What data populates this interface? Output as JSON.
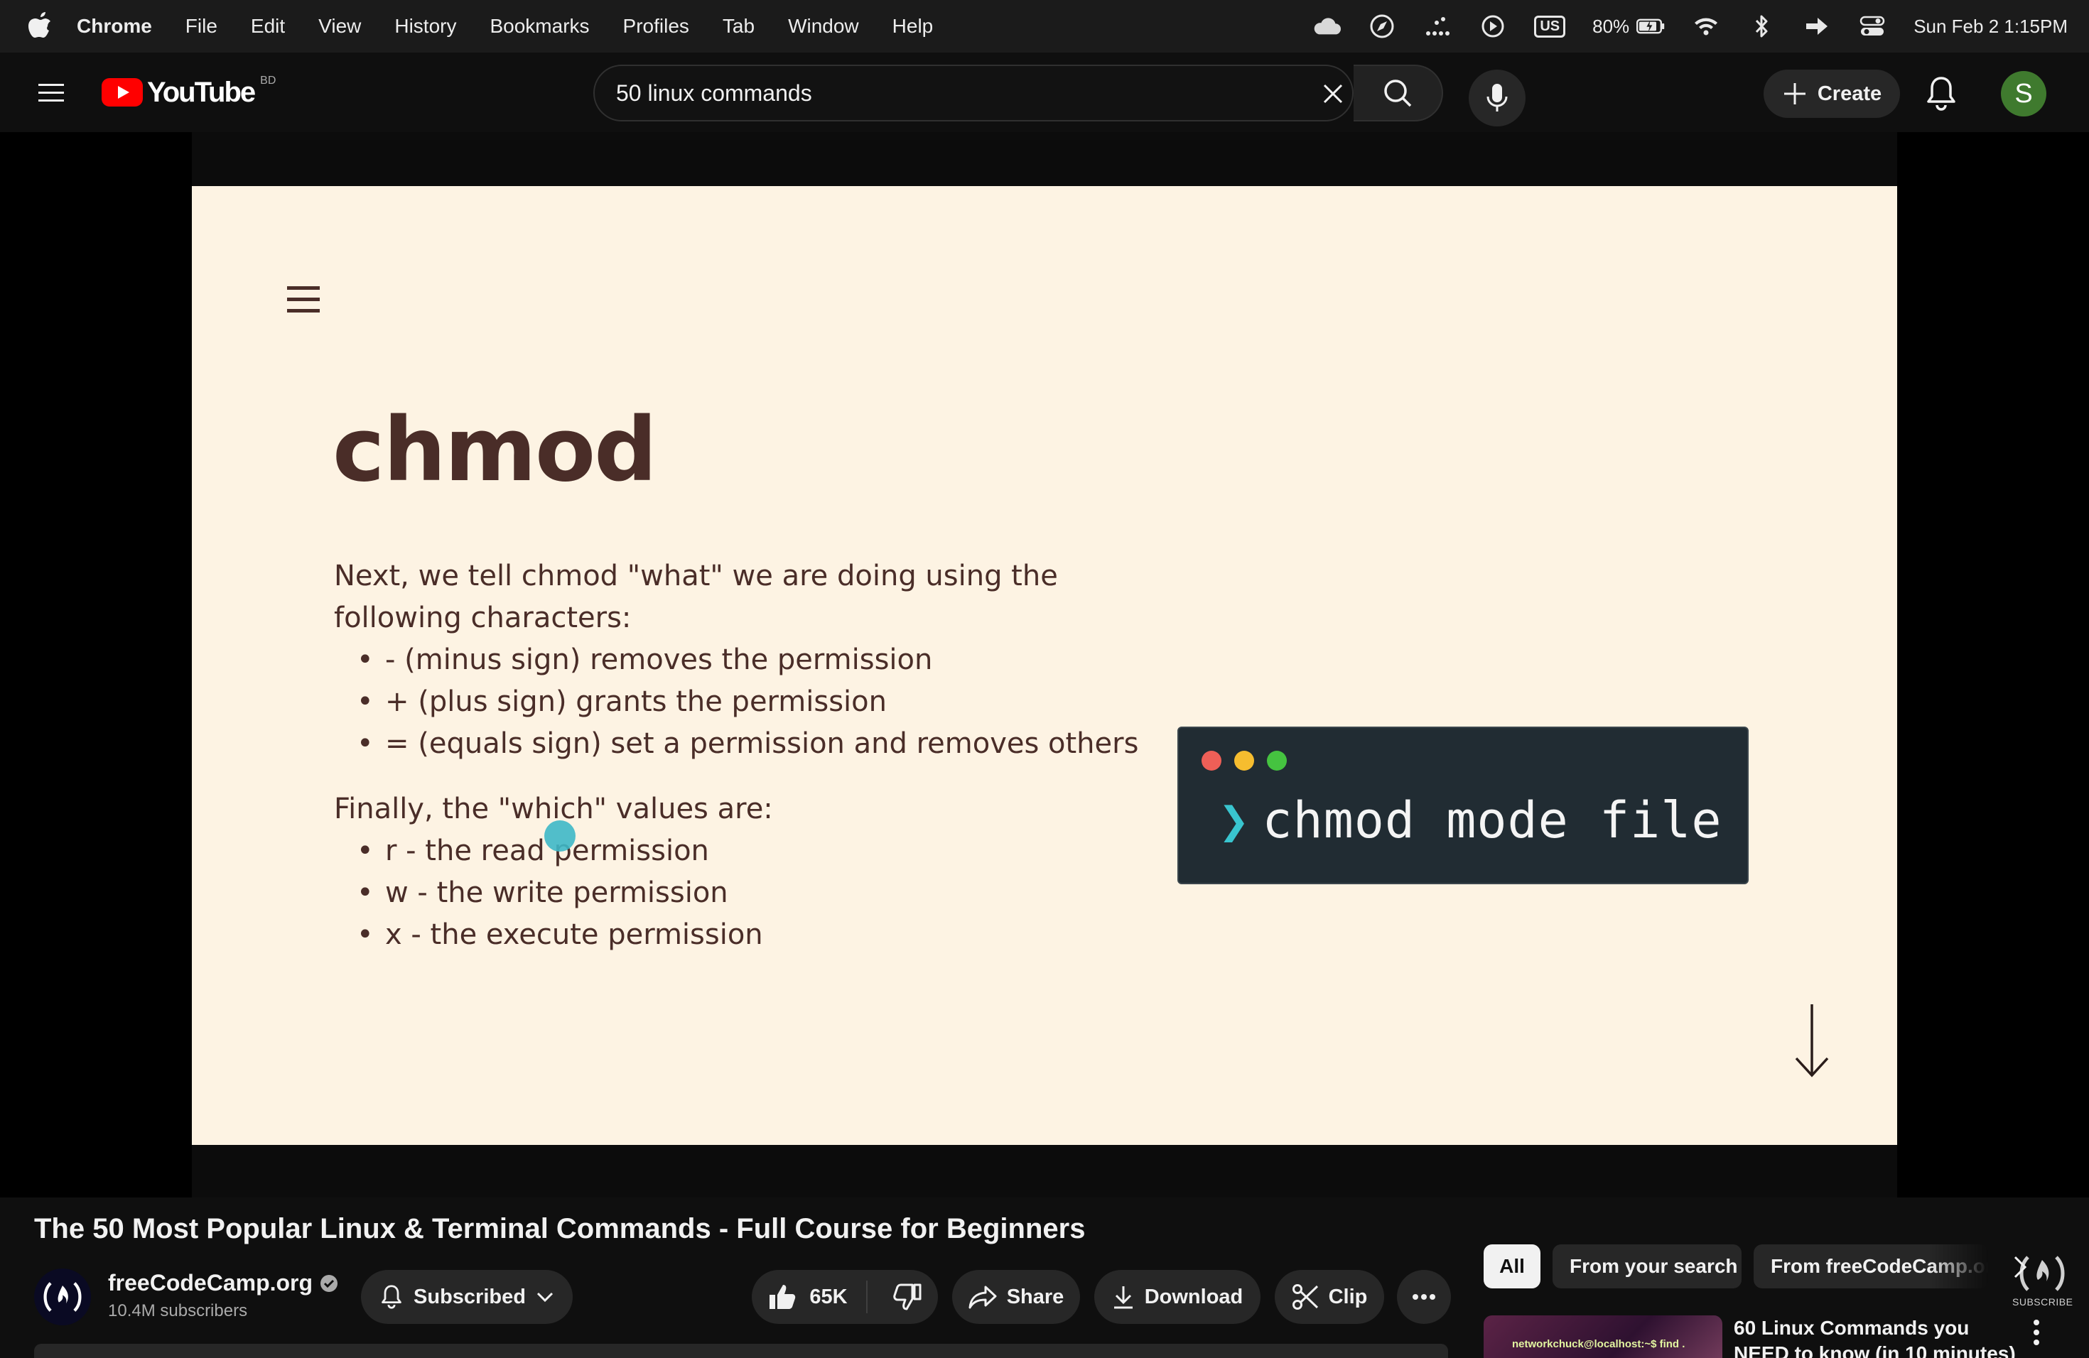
{
  "menubar": {
    "items": [
      "Chrome",
      "File",
      "Edit",
      "View",
      "History",
      "Bookmarks",
      "Profiles",
      "Tab",
      "Window",
      "Help"
    ],
    "keyboard_layout": "US",
    "battery": "80%",
    "datetime": "Sun Feb 2  1:15PM"
  },
  "header": {
    "logo_text": "YouTube",
    "logo_country": "BD",
    "search_value": "50 linux commands",
    "create_label": "Create",
    "avatar_letter": "S"
  },
  "slide": {
    "title": "chmod",
    "intro": [
      "Next, we tell chmod \"what\" we are doing using the",
      "following characters:"
    ],
    "operators": [
      "- (minus sign) removes the permission",
      "+ (plus sign) grants the permission",
      "= (equals sign) set a permission and removes others"
    ],
    "which_heading": "Finally, the \"which\" values are:",
    "which_values": [
      "r - the read permission",
      "w - the write permission",
      "x - the execute permission"
    ],
    "terminal_prompt": "❯",
    "terminal_command": "chmod mode file",
    "watermark_label": "SUBSCRIBE"
  },
  "video": {
    "title": "The 50 Most Popular Linux & Terminal Commands - Full Course for Beginners",
    "channel_name": "freeCodeCamp.org",
    "channel_subscribers": "10.4M subscribers",
    "subscribed_label": "Subscribed",
    "likes": "65K",
    "share_label": "Share",
    "download_label": "Download",
    "clip_label": "Clip"
  },
  "sidebar": {
    "chips": [
      "All",
      "From your search",
      "From freeCodeCamp.org"
    ],
    "recommendation": {
      "title": "60 Linux Commands you NEED to know (in 10 minutes)",
      "thumb_text": "networkchuck@localhost:~$ find ."
    }
  },
  "colors": {
    "yt_red": "#ff0000",
    "slide_bg": "#fdf3e3",
    "slide_text": "#4a2d28",
    "terminal_bg": "#212c33",
    "prompt": "#39c5cf"
  }
}
